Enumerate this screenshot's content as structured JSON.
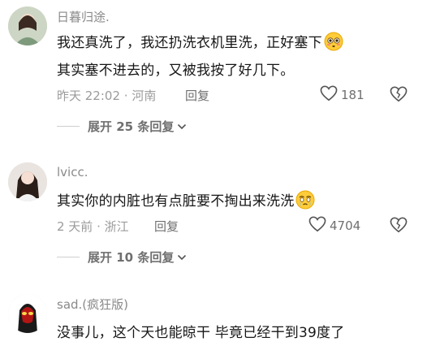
{
  "comments": [
    {
      "username": "日暮归途.",
      "lines": [
        "我还真洗了，我还扔洗衣机里洗，正好塞下",
        "其实塞不进去的，又被我按了好几下。"
      ],
      "time": "昨天 22:02",
      "location": "河南",
      "reply_label": "回复",
      "likes": "181",
      "expand_label": "展开 25 条回复"
    },
    {
      "username": "lvicc.",
      "lines": [
        "其实你的内脏也有点脏要不掏出来洗洗"
      ],
      "time": "2 天前",
      "location": "浙江",
      "reply_label": "回复",
      "likes": "4704",
      "expand_label": "展开 10 条回复"
    },
    {
      "username": "sad.(疯狂版)",
      "lines": [
        "没事儿，这个天也能晾干 毕竟已经干到39度了"
      ]
    }
  ]
}
